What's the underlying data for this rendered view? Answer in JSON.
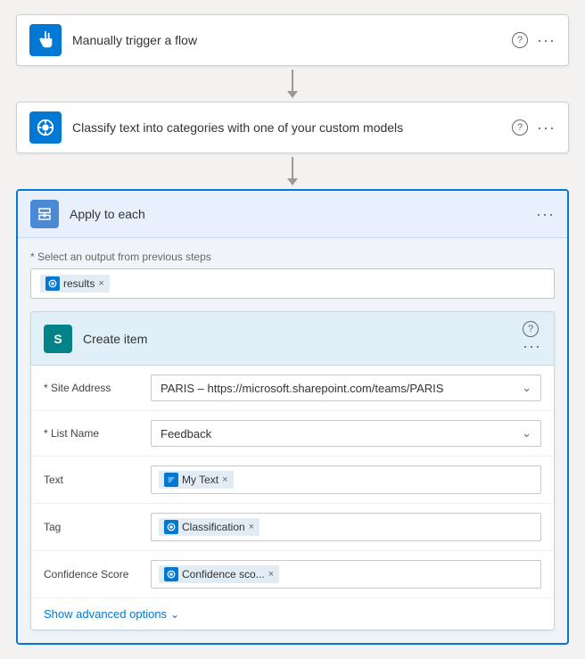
{
  "steps": {
    "trigger": {
      "title": "Manually trigger a flow",
      "icon_type": "hand"
    },
    "classify": {
      "title": "Classify text into categories with one of your custom models",
      "icon_type": "ai"
    }
  },
  "apply_each": {
    "header_title": "Apply to each",
    "select_label": "* Select an output from previous steps",
    "tag_chip_label": "results",
    "create_item": {
      "title": "Create item",
      "sharepoint_letter": "S",
      "fields": {
        "site_address": {
          "label": "* Site Address",
          "value": "PARIS – https://microsoft.sharepoint.com/teams/PARIS"
        },
        "list_name": {
          "label": "* List Name",
          "value": "Feedback"
        },
        "text": {
          "label": "Text",
          "chip": "My Text"
        },
        "tag": {
          "label": "Tag",
          "chip": "Classification"
        },
        "confidence_score": {
          "label": "Confidence Score",
          "chip": "Confidence sco..."
        }
      },
      "show_advanced": "Show advanced options"
    }
  }
}
